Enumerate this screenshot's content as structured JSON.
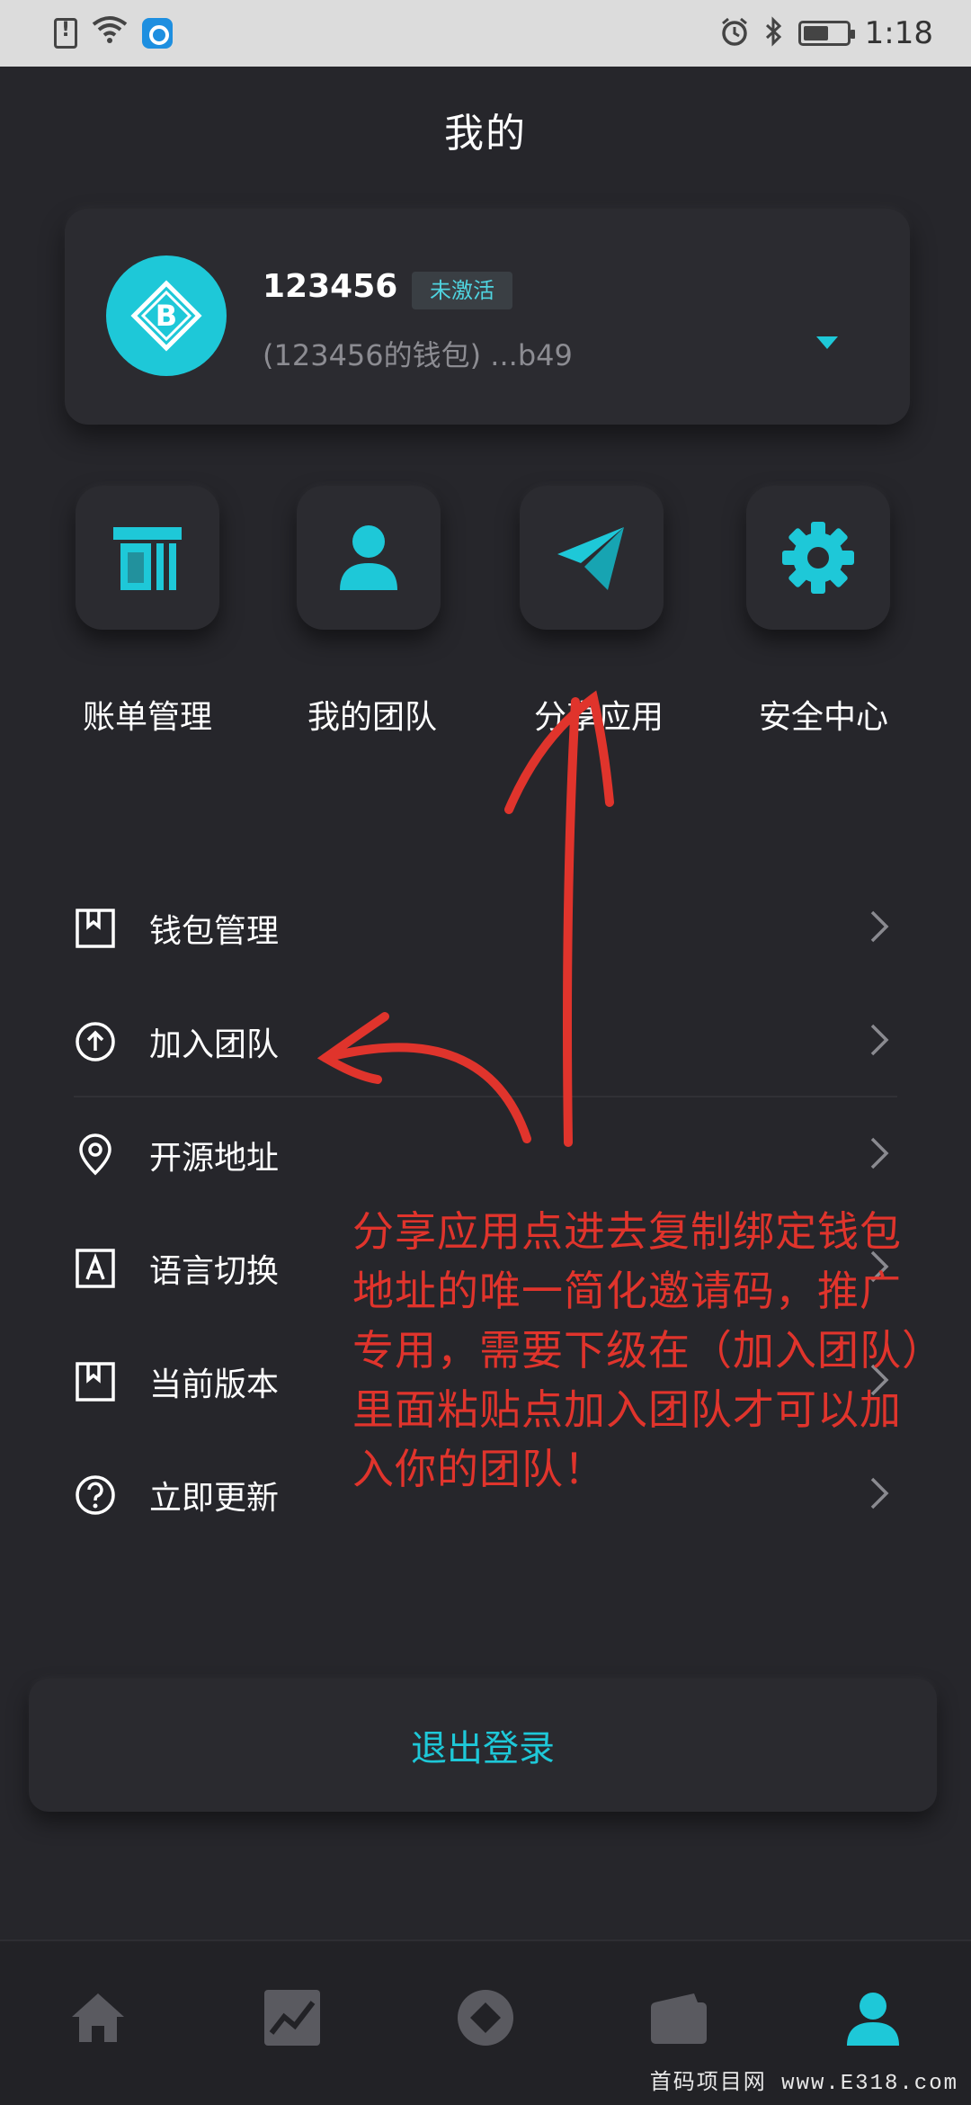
{
  "status_bar": {
    "time": "1:18",
    "icons": [
      "sim-alert-icon",
      "wifi-icon",
      "app-notification-icon",
      "alarm-icon",
      "bluetooth-icon",
      "battery-icon"
    ]
  },
  "header": {
    "title": "我的"
  },
  "profile": {
    "username": "123456",
    "status_badge": "未激活",
    "wallet_line": "(123456的钱包) ...b49",
    "avatar_icon": "bitcoin-diamond-logo",
    "dropdown_icon": "caret-down-icon"
  },
  "quick_actions": [
    {
      "label": "账单管理",
      "icon": "bill-icon"
    },
    {
      "label": "我的团队",
      "icon": "user-icon"
    },
    {
      "label": "分享应用",
      "icon": "send-icon"
    },
    {
      "label": "安全中心",
      "icon": "gear-icon"
    }
  ],
  "menu": [
    {
      "label": "钱包管理",
      "icon": "bookmark-icon"
    },
    {
      "label": "加入团队",
      "icon": "arrow-up-circle-icon"
    },
    {
      "label": "开源地址",
      "icon": "location-pin-icon"
    },
    {
      "label": "语言切换",
      "icon": "language-a-icon"
    },
    {
      "label": "当前版本",
      "icon": "bookmark-icon"
    },
    {
      "label": "立即更新",
      "icon": "help-circle-icon"
    }
  ],
  "logout": {
    "label": "退出登录"
  },
  "bottom_nav": [
    {
      "icon": "home-icon",
      "active": false
    },
    {
      "icon": "chart-icon",
      "active": false
    },
    {
      "icon": "coin-icon",
      "active": false
    },
    {
      "icon": "wallet-icon",
      "active": false
    },
    {
      "icon": "profile-icon",
      "active": true
    }
  ],
  "annotation": {
    "text": "分享应用点进去复制绑定钱包地址的唯一简化邀请码，推广专用，需要下级在（加入团队）里面粘贴点加入团队才可以加入你的团队！"
  },
  "watermark": "首码项目网 www.E318.com",
  "colors": {
    "accent": "#1ec8d8",
    "background": "#26262b",
    "card": "#2b2b30",
    "annotation": "#e0342c"
  }
}
